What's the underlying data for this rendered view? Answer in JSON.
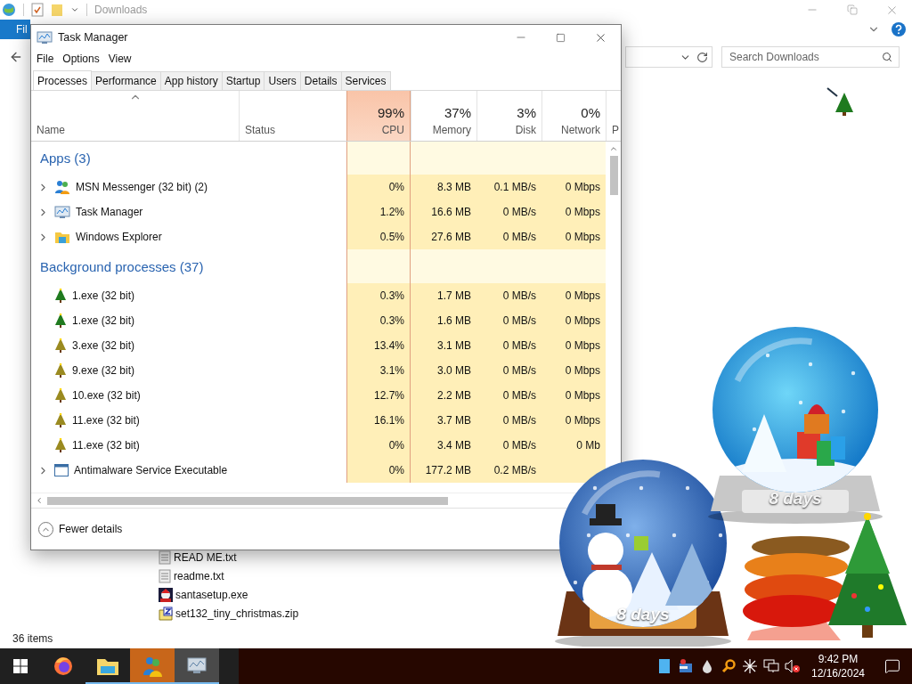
{
  "explorer": {
    "title": "Downloads",
    "ribbon_tab": "Fil",
    "search": {
      "placeholder": "Search Downloads"
    },
    "files": [
      {
        "name": "READ ME.txt",
        "kind": "text"
      },
      {
        "name": "readme.txt",
        "kind": "text"
      },
      {
        "name": "santasetup.exe",
        "kind": "exe"
      },
      {
        "name": "set132_tiny_christmas.zip",
        "kind": "zip"
      }
    ],
    "status": "36 items"
  },
  "task_manager": {
    "title": "Task Manager",
    "menu": [
      "File",
      "Options",
      "View"
    ],
    "tabs": [
      {
        "label": "Processes",
        "selected": true
      },
      {
        "label": "Performance",
        "selected": false
      },
      {
        "label": "App history",
        "selected": false
      },
      {
        "label": "Startup",
        "selected": false
      },
      {
        "label": "Users",
        "selected": false
      },
      {
        "label": "Details",
        "selected": false
      },
      {
        "label": "Services",
        "selected": false
      }
    ],
    "columns": [
      {
        "label": "Name",
        "sorted": true,
        "highlighted": false
      },
      {
        "label": "Status",
        "sorted": false,
        "highlighted": false
      },
      {
        "label": "CPU",
        "usage": "99%",
        "sorted": false,
        "highlighted": true
      },
      {
        "label": "Memory",
        "usage": "37%",
        "sorted": false,
        "highlighted": false
      },
      {
        "label": "Disk",
        "usage": "3%",
        "sorted": false,
        "highlighted": false
      },
      {
        "label": "Network",
        "usage": "0%",
        "sorted": false,
        "highlighted": false
      },
      {
        "label": "P",
        "sorted": false,
        "highlighted": false
      }
    ],
    "groups": [
      {
        "title": "Apps (3)",
        "processes": [
          {
            "name": "MSN Messenger (32 bit) (2)",
            "kind": "messenger",
            "expandable": true,
            "cpu": "0%",
            "memory": "8.3 MB",
            "disk": "0.1 MB/s",
            "network": "0 Mbps"
          },
          {
            "name": "Task Manager",
            "kind": "monitor",
            "expandable": true,
            "cpu": "1.2%",
            "memory": "16.6 MB",
            "disk": "0 MB/s",
            "network": "0 Mbps"
          },
          {
            "name": "Windows Explorer",
            "kind": "folder",
            "expandable": true,
            "cpu": "0.5%",
            "memory": "27.6 MB",
            "disk": "0 MB/s",
            "network": "0 Mbps"
          }
        ]
      },
      {
        "title": "Background processes (37)",
        "processes": [
          {
            "name": "1.exe (32 bit)",
            "kind": "green-tree",
            "expandable": false,
            "cpu": "0.3%",
            "memory": "1.7 MB",
            "disk": "0 MB/s",
            "network": "0 Mbps"
          },
          {
            "name": "1.exe (32 bit)",
            "kind": "green-tree",
            "expandable": false,
            "cpu": "0.3%",
            "memory": "1.6 MB",
            "disk": "0 MB/s",
            "network": "0 Mbps"
          },
          {
            "name": "3.exe (32 bit)",
            "kind": "tree",
            "expandable": false,
            "cpu": "13.4%",
            "memory": "3.1 MB",
            "disk": "0 MB/s",
            "network": "0 Mbps"
          },
          {
            "name": "9.exe (32 bit)",
            "kind": "tree",
            "expandable": false,
            "cpu": "3.1%",
            "memory": "3.0 MB",
            "disk": "0 MB/s",
            "network": "0 Mbps"
          },
          {
            "name": "10.exe (32 bit)",
            "kind": "tree",
            "expandable": false,
            "cpu": "12.7%",
            "memory": "2.2 MB",
            "disk": "0 MB/s",
            "network": "0 Mbps"
          },
          {
            "name": "11.exe (32 bit)",
            "kind": "tree",
            "expandable": false,
            "cpu": "16.1%",
            "memory": "3.7 MB",
            "disk": "0 MB/s",
            "network": "0 Mbps"
          },
          {
            "name": "11.exe (32 bit)",
            "kind": "tree",
            "expandable": false,
            "cpu": "0%",
            "memory": "3.4 MB",
            "disk": "0 MB/s",
            "network": "0 Mb"
          },
          {
            "name": "Antimalware Service Executable",
            "kind": "service",
            "expandable": true,
            "cpu": "0%",
            "memory": "177.2 MB",
            "disk": "0.2 MB/s"
          }
        ]
      }
    ],
    "footer": "Fewer details"
  },
  "gadgets": [
    {
      "kind": "snowman",
      "label": "8 days"
    },
    {
      "kind": "presents",
      "label": "8 days"
    },
    {
      "kind": "spring-tree"
    }
  ],
  "taskbar": {
    "apps": [
      {
        "kind": "firefox",
        "open": false,
        "selected": false,
        "attention": false
      },
      {
        "kind": "explorer",
        "open": true,
        "selected": false,
        "attention": false
      },
      {
        "kind": "messenger",
        "open": true,
        "selected": false,
        "attention": true
      },
      {
        "kind": "monitor",
        "open": true,
        "selected": true,
        "attention": false
      }
    ],
    "time": "9:42 PM",
    "date": "12/16/2024"
  }
}
